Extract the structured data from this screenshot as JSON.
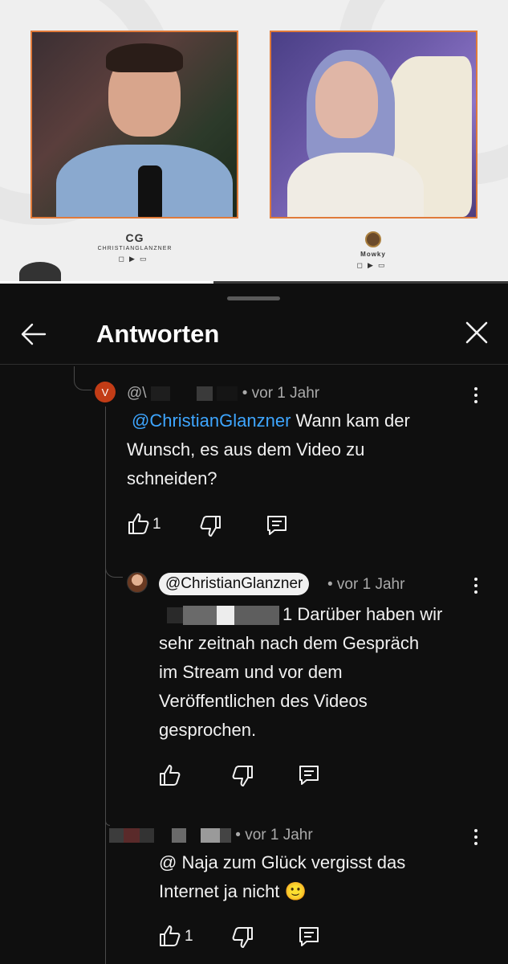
{
  "video": {
    "left_brand": {
      "logo": "CG",
      "name": "CHRISTIANGLANZNER"
    },
    "right_brand": {
      "name": "Mowky"
    },
    "progress": 0.42
  },
  "panel": {
    "title": "Antworten"
  },
  "comments": [
    {
      "avatar_letter": "V",
      "handle": "@\\",
      "time": "• vor 1 Jahr",
      "mention": "@ChristianGlanzner",
      "text_line1": " Wann kam der",
      "text_line2": "Wunsch, es aus dem Video zu",
      "text_line3": "schneiden?",
      "like_count": "1"
    },
    {
      "handle": "@ChristianGlanzner",
      "time": "• vor 1 Jahr",
      "text_line1_suffix": "1 Darüber haben wir",
      "text_line2": "sehr zeitnah nach dem Gespräch",
      "text_line3": "im Stream und vor dem",
      "text_line4": "Veröffentlichen des Videos",
      "text_line5": "gesprochen."
    },
    {
      "time": "• vor 1 Jahr",
      "text_line1": "@ Naja zum Glück vergisst das",
      "text_line2": "Internet ja nicht 🙂",
      "like_count": "1"
    }
  ],
  "icons": {
    "back": "arrow-left-icon",
    "close": "close-icon",
    "like": "thumbs-up-icon",
    "dislike": "thumbs-down-icon",
    "reply": "reply-comment-icon",
    "more": "more-vertical-icon"
  },
  "colors": {
    "background": "#0f0f0f",
    "mention": "#3ea6ff",
    "avatar_v": "#c23c16",
    "cam_border": "#e07a3a"
  }
}
